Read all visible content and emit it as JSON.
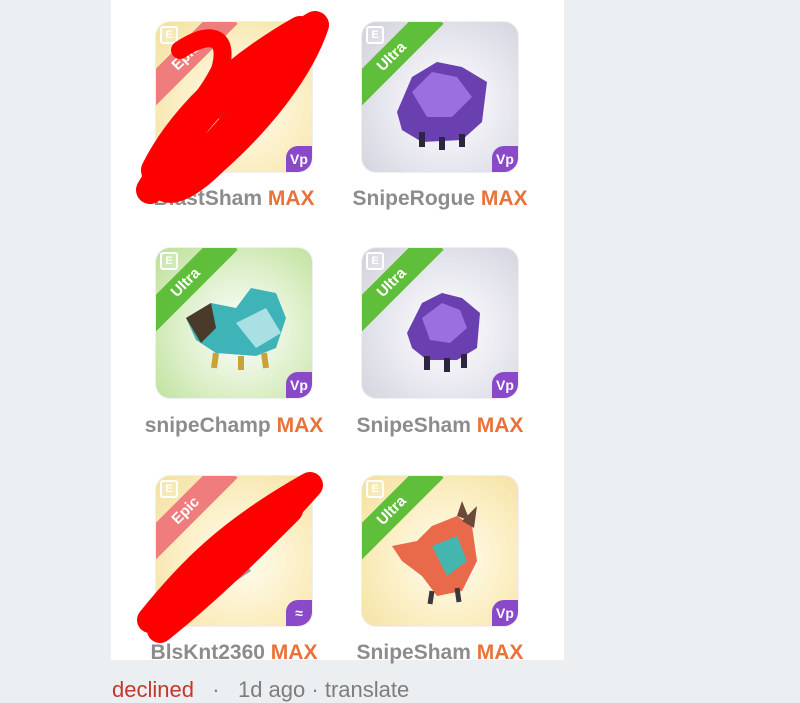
{
  "cards": [
    {
      "name": "BlastSham",
      "level": "MAX",
      "rarity": "Epic",
      "element": "Vp",
      "redacted": true
    },
    {
      "name": "SnipeRogue",
      "level": "MAX",
      "rarity": "Ultra",
      "element": "Vp",
      "redacted": false
    },
    {
      "name": "snipeChamp",
      "level": "MAX",
      "rarity": "Ultra",
      "element": "Vp",
      "redacted": false
    },
    {
      "name": "SnipeSham",
      "level": "MAX",
      "rarity": "Ultra",
      "element": "Vp",
      "redacted": false
    },
    {
      "name": "BlsKnt2360",
      "level": "MAX",
      "rarity": "Epic",
      "element": "≈",
      "redacted": true
    },
    {
      "name": "SnipeSham",
      "level": "MAX",
      "rarity": "Ultra",
      "element": "Vp",
      "redacted": false
    }
  ],
  "footer": {
    "status": "declined",
    "sep1": "·",
    "time": "1d ago",
    "sep2": "·",
    "action": "translate"
  },
  "colors": {
    "epic": "#ef7d7d",
    "ultra": "#5fbf3b",
    "max": "#e8733a",
    "declined": "#c0392b",
    "redaction": "#ff0000"
  },
  "icons": [
    "catalog-icon",
    "element-icon",
    "dragon-image"
  ]
}
